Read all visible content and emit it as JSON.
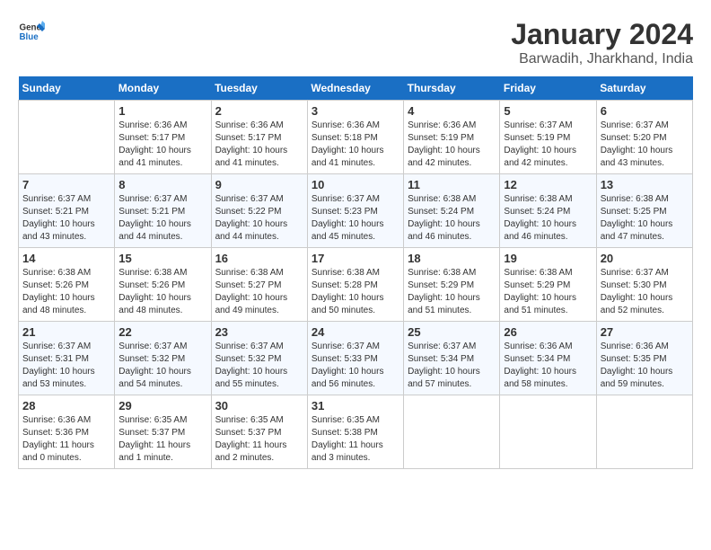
{
  "header": {
    "logo_line1": "General",
    "logo_line2": "Blue",
    "title": "January 2024",
    "subtitle": "Barwadih, Jharkhand, India"
  },
  "days_of_week": [
    "Sunday",
    "Monday",
    "Tuesday",
    "Wednesday",
    "Thursday",
    "Friday",
    "Saturday"
  ],
  "weeks": [
    [
      {
        "day": "",
        "info": ""
      },
      {
        "day": "1",
        "info": "Sunrise: 6:36 AM\nSunset: 5:17 PM\nDaylight: 10 hours\nand 41 minutes."
      },
      {
        "day": "2",
        "info": "Sunrise: 6:36 AM\nSunset: 5:17 PM\nDaylight: 10 hours\nand 41 minutes."
      },
      {
        "day": "3",
        "info": "Sunrise: 6:36 AM\nSunset: 5:18 PM\nDaylight: 10 hours\nand 41 minutes."
      },
      {
        "day": "4",
        "info": "Sunrise: 6:36 AM\nSunset: 5:19 PM\nDaylight: 10 hours\nand 42 minutes."
      },
      {
        "day": "5",
        "info": "Sunrise: 6:37 AM\nSunset: 5:19 PM\nDaylight: 10 hours\nand 42 minutes."
      },
      {
        "day": "6",
        "info": "Sunrise: 6:37 AM\nSunset: 5:20 PM\nDaylight: 10 hours\nand 43 minutes."
      }
    ],
    [
      {
        "day": "7",
        "info": "Sunrise: 6:37 AM\nSunset: 5:21 PM\nDaylight: 10 hours\nand 43 minutes."
      },
      {
        "day": "8",
        "info": "Sunrise: 6:37 AM\nSunset: 5:21 PM\nDaylight: 10 hours\nand 44 minutes."
      },
      {
        "day": "9",
        "info": "Sunrise: 6:37 AM\nSunset: 5:22 PM\nDaylight: 10 hours\nand 44 minutes."
      },
      {
        "day": "10",
        "info": "Sunrise: 6:37 AM\nSunset: 5:23 PM\nDaylight: 10 hours\nand 45 minutes."
      },
      {
        "day": "11",
        "info": "Sunrise: 6:38 AM\nSunset: 5:24 PM\nDaylight: 10 hours\nand 46 minutes."
      },
      {
        "day": "12",
        "info": "Sunrise: 6:38 AM\nSunset: 5:24 PM\nDaylight: 10 hours\nand 46 minutes."
      },
      {
        "day": "13",
        "info": "Sunrise: 6:38 AM\nSunset: 5:25 PM\nDaylight: 10 hours\nand 47 minutes."
      }
    ],
    [
      {
        "day": "14",
        "info": "Sunrise: 6:38 AM\nSunset: 5:26 PM\nDaylight: 10 hours\nand 48 minutes."
      },
      {
        "day": "15",
        "info": "Sunrise: 6:38 AM\nSunset: 5:26 PM\nDaylight: 10 hours\nand 48 minutes."
      },
      {
        "day": "16",
        "info": "Sunrise: 6:38 AM\nSunset: 5:27 PM\nDaylight: 10 hours\nand 49 minutes."
      },
      {
        "day": "17",
        "info": "Sunrise: 6:38 AM\nSunset: 5:28 PM\nDaylight: 10 hours\nand 50 minutes."
      },
      {
        "day": "18",
        "info": "Sunrise: 6:38 AM\nSunset: 5:29 PM\nDaylight: 10 hours\nand 51 minutes."
      },
      {
        "day": "19",
        "info": "Sunrise: 6:38 AM\nSunset: 5:29 PM\nDaylight: 10 hours\nand 51 minutes."
      },
      {
        "day": "20",
        "info": "Sunrise: 6:37 AM\nSunset: 5:30 PM\nDaylight: 10 hours\nand 52 minutes."
      }
    ],
    [
      {
        "day": "21",
        "info": "Sunrise: 6:37 AM\nSunset: 5:31 PM\nDaylight: 10 hours\nand 53 minutes."
      },
      {
        "day": "22",
        "info": "Sunrise: 6:37 AM\nSunset: 5:32 PM\nDaylight: 10 hours\nand 54 minutes."
      },
      {
        "day": "23",
        "info": "Sunrise: 6:37 AM\nSunset: 5:32 PM\nDaylight: 10 hours\nand 55 minutes."
      },
      {
        "day": "24",
        "info": "Sunrise: 6:37 AM\nSunset: 5:33 PM\nDaylight: 10 hours\nand 56 minutes."
      },
      {
        "day": "25",
        "info": "Sunrise: 6:37 AM\nSunset: 5:34 PM\nDaylight: 10 hours\nand 57 minutes."
      },
      {
        "day": "26",
        "info": "Sunrise: 6:36 AM\nSunset: 5:34 PM\nDaylight: 10 hours\nand 58 minutes."
      },
      {
        "day": "27",
        "info": "Sunrise: 6:36 AM\nSunset: 5:35 PM\nDaylight: 10 hours\nand 59 minutes."
      }
    ],
    [
      {
        "day": "28",
        "info": "Sunrise: 6:36 AM\nSunset: 5:36 PM\nDaylight: 11 hours\nand 0 minutes."
      },
      {
        "day": "29",
        "info": "Sunrise: 6:35 AM\nSunset: 5:37 PM\nDaylight: 11 hours\nand 1 minute."
      },
      {
        "day": "30",
        "info": "Sunrise: 6:35 AM\nSunset: 5:37 PM\nDaylight: 11 hours\nand 2 minutes."
      },
      {
        "day": "31",
        "info": "Sunrise: 6:35 AM\nSunset: 5:38 PM\nDaylight: 11 hours\nand 3 minutes."
      },
      {
        "day": "",
        "info": ""
      },
      {
        "day": "",
        "info": ""
      },
      {
        "day": "",
        "info": ""
      }
    ]
  ]
}
